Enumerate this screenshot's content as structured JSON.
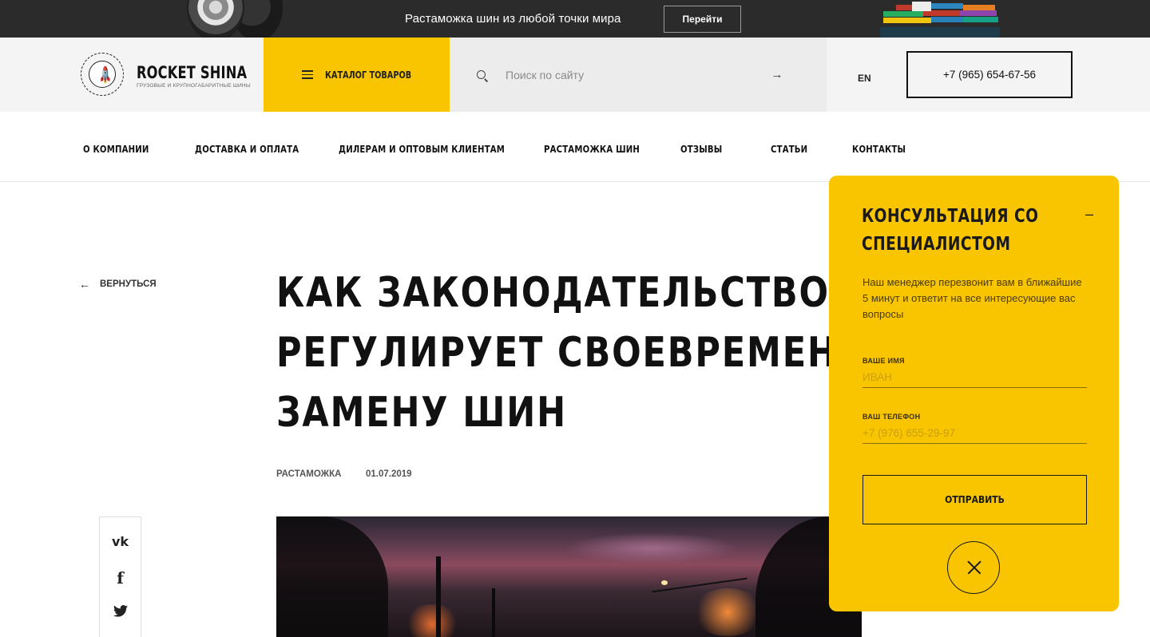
{
  "banner": {
    "text": "Растаможка шин из любой точки мира",
    "button_label": "Перейти"
  },
  "header": {
    "logo_title": "ROCKET SHINA",
    "logo_subtitle": "ГРУЗОВЫЕ И КРУПНОГАБАРИТНЫЕ ШИНЫ",
    "catalog_label": "КАТАЛОГ ТОВАРОВ",
    "search_placeholder": "Поиск по сайту",
    "language": "EN",
    "phone": "+7 (965) 654-67-56"
  },
  "nav": {
    "items": [
      {
        "label": "О КОМПАНИИ"
      },
      {
        "label": "ДОСТАВКА И ОПЛАТА"
      },
      {
        "label": "ДИЛЕРАМ И ОПТОВЫМ КЛИЕНТАМ"
      },
      {
        "label": "РАСТАМОЖКА ШИН"
      },
      {
        "label": "ОТЗЫВЫ"
      },
      {
        "label": "СТАТЬИ"
      },
      {
        "label": "КОНТАКТЫ"
      }
    ]
  },
  "article": {
    "back_label": "ВЕРНУТЬСЯ",
    "title_lines": [
      "КАК ЗАКОНОДАТЕЛЬСТВО",
      "РЕГУЛИРУЕТ СВОЕВРЕМЕННУЮ",
      "ЗАМЕНУ ШИН"
    ],
    "category": "РАСТАМОЖКА",
    "date": "01.07.2019"
  },
  "share": {
    "icons": [
      "vk-icon",
      "facebook-icon",
      "twitter-icon"
    ]
  },
  "consult": {
    "title_lines": [
      "КОНСУЛЬТАЦИЯ СО",
      "СПЕЦИАЛИСТОМ"
    ],
    "minimize_label": "–",
    "description": "Наш менеджер перезвонит вам в ближайшие 5 минут и ответит на все интересующие вас вопросы",
    "name_label": "ВАШЕ ИМЯ",
    "name_placeholder": "ИВАН",
    "phone_label": "ВАШ ТЕЛЕФОН",
    "phone_placeholder": "+7 (976) 655-29-97",
    "submit_label": "ОТПРАВИТЬ"
  },
  "colors": {
    "accent": "#f9c400",
    "topbar": "#2b2b2b",
    "header_bg": "#f4f4f4",
    "search_bg": "#ececec"
  }
}
